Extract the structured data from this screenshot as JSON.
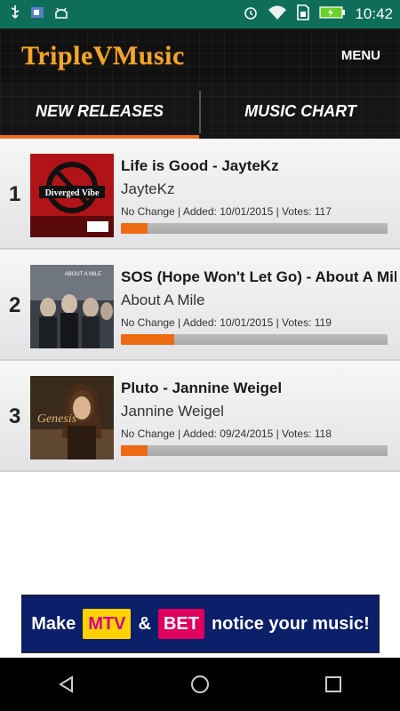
{
  "status_bar": {
    "time": "10:42",
    "icons": [
      "usb-icon",
      "image-icon",
      "android-icon",
      "alarm-icon",
      "wifi-icon",
      "sim-icon",
      "battery-icon"
    ]
  },
  "header": {
    "logo_text": "TripleVMusic",
    "menu_label": "MENU"
  },
  "tabs": [
    {
      "label": "NEW RELEASES",
      "active": true
    },
    {
      "label": "MUSIC CHART",
      "active": false
    }
  ],
  "releases": [
    {
      "rank": "1",
      "title": "Life is Good - JayteKz",
      "artist": "JayteKz",
      "meta": "No Change | Added: 10/01/2015 | Votes: 117",
      "progress": 0.1,
      "art_text": "Diverged Vibe"
    },
    {
      "rank": "2",
      "title": "SOS (Hope Won't Let Go) - About A Mile",
      "artist": "About A Mile",
      "meta": "No Change | Added: 10/01/2015 | Votes: 119",
      "progress": 0.2,
      "art_text": "ABOUT A MILE"
    },
    {
      "rank": "3",
      "title": "Pluto - Jannine Weigel",
      "artist": "Jannine Weigel",
      "meta": "No Change | Added: 09/24/2015 | Votes: 118",
      "progress": 0.1,
      "art_text": "Genesis"
    }
  ],
  "ad": {
    "text_before": "Make",
    "brand1": "MTV",
    "amp": "&",
    "brand2": "BET",
    "text_after": "notice your music!"
  },
  "colors": {
    "accent": "#ef6c1a",
    "status_bar": "#0e6e59",
    "logo": "#f1a52b"
  }
}
